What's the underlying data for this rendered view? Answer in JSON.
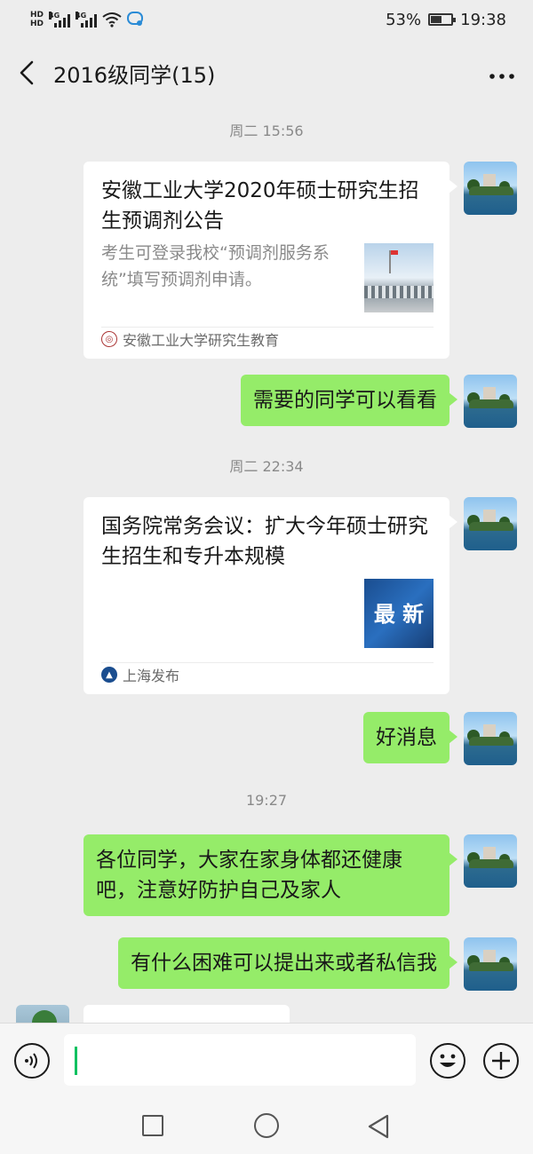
{
  "status_bar": {
    "hd1": "HD",
    "hd2": "HD",
    "network1": "4G",
    "network2": "4G",
    "battery_percent": "53%",
    "battery_level": 0.53,
    "time": "19:38"
  },
  "header": {
    "title": "2016级同学(15)"
  },
  "messages": {
    "time1": "周二 15:56",
    "card1": {
      "title": "安徽工业大学2020年硕士研究生招生预调剂公告",
      "desc": "考生可登录我校“预调剂服务系统”填写预调剂申请。",
      "source": "安徽工业大学研究生教育"
    },
    "msg1": "需要的同学可以看看",
    "time2": "周二 22:34",
    "card2": {
      "title": "国务院常务会议：扩大今年硕士研究生招生和专升本规模",
      "thumb_text": "最 新",
      "source": "上海发布"
    },
    "msg2": "好消息",
    "time3": "19:27",
    "msg3": "各位同学，大家在家身体都还健康吧，注意好防护自己及家人",
    "msg4": "有什么困难可以提出来或者私信我"
  },
  "colors": {
    "bubble_green": "#95ec69",
    "background": "#ededed",
    "caret_green": "#07c160"
  }
}
